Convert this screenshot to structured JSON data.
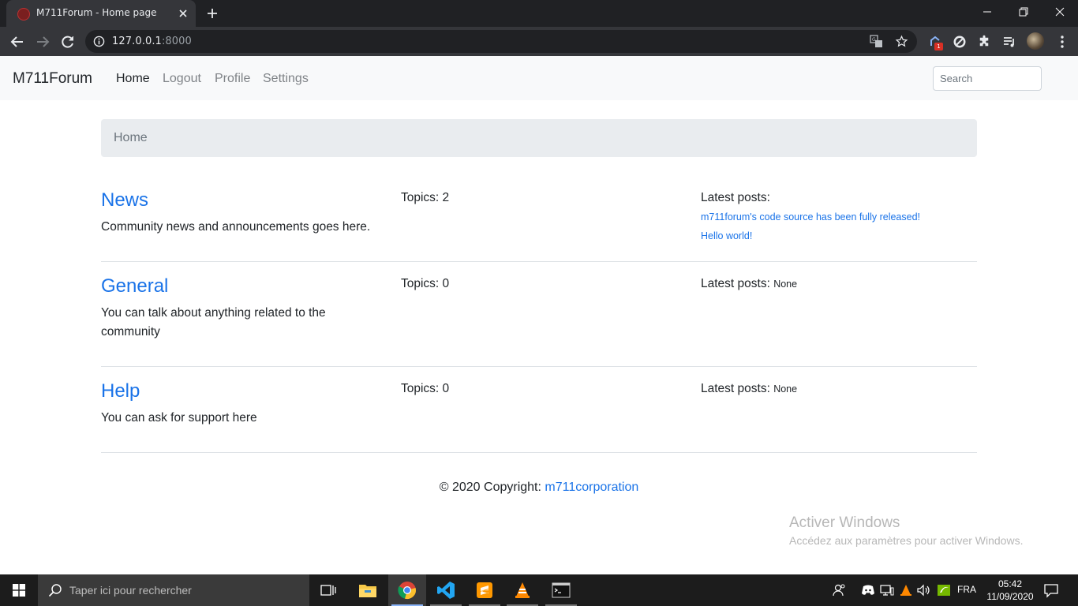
{
  "browser": {
    "tab_title": "M711Forum - Home page",
    "url_host": "127.0.0.1",
    "url_port": ":8000",
    "extension_badge": "1"
  },
  "navbar": {
    "brand": "M711Forum",
    "links": [
      "Home",
      "Logout",
      "Profile",
      "Settings"
    ],
    "active_link": "Home",
    "search_placeholder": "Search"
  },
  "breadcrumb": "Home",
  "forums": [
    {
      "title": "News",
      "description": "Community news and announcements goes here.",
      "topics_label": "Topics: 2",
      "latest_label": "Latest posts:",
      "latest_posts": [
        "m711forum's code source has been fully released!",
        "Hello world!"
      ],
      "latest_none": ""
    },
    {
      "title": "General",
      "description": "You can talk about anything related to the community",
      "topics_label": "Topics: 0",
      "latest_label": "Latest posts:",
      "latest_posts": [],
      "latest_none": "None"
    },
    {
      "title": "Help",
      "description": "You can ask for support here",
      "topics_label": "Topics: 0",
      "latest_label": "Latest posts:",
      "latest_posts": [],
      "latest_none": "None"
    }
  ],
  "footer": {
    "text": "© 2020 Copyright: ",
    "link": "m711corporation"
  },
  "watermark": {
    "title": "Activer Windows",
    "subtitle": "Accédez aux paramètres pour activer Windows."
  },
  "taskbar": {
    "search_placeholder": "Taper ici pour rechercher",
    "language": "FRA",
    "time": "05:42",
    "date": "11/09/2020"
  },
  "colors": {
    "link": "#1a73e8",
    "navbar_bg": "#f8f9fa",
    "breadcrumb_bg": "#e9ecef",
    "chrome_dark": "#202124",
    "chrome_toolbar": "#35363a",
    "taskbar": "#1c1c1c"
  }
}
